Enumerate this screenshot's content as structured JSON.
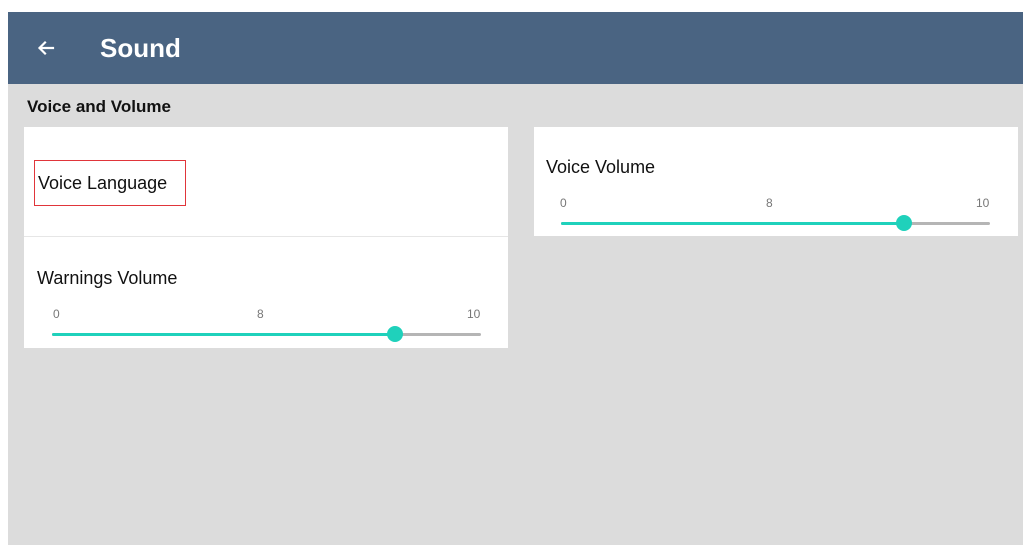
{
  "appbar": {
    "title": "Sound",
    "back_icon": "arrow-left-icon"
  },
  "section": {
    "title": "Voice and Volume"
  },
  "voice_language": {
    "label": "Voice Language"
  },
  "warnings_volume": {
    "label": "Warnings Volume",
    "min": "0",
    "max": "10",
    "current": "8",
    "value": 8,
    "range": [
      0,
      10
    ]
  },
  "voice_volume": {
    "label": "Voice Volume",
    "min": "0",
    "max": "10",
    "current": "8",
    "value": 8,
    "range": [
      0,
      10
    ]
  },
  "colors": {
    "appbar": "#4a6482",
    "background": "#dcdcdc",
    "accent": "#1fd1bb",
    "track": "#b5b5b5",
    "highlight_border": "#e0353a"
  }
}
